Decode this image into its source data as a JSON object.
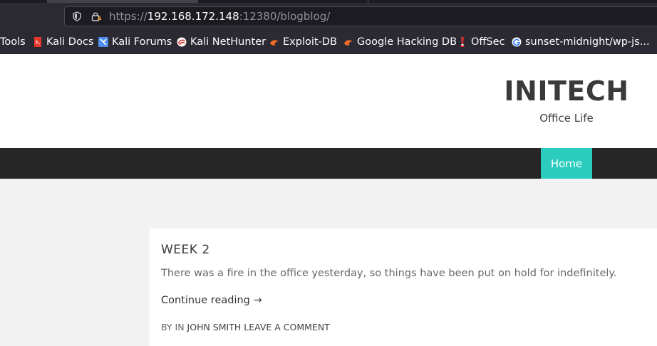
{
  "browser": {
    "url_prefix": "https://",
    "url_host": "192.168.172.148",
    "url_rest": ":12380/blogblog/",
    "bookmarks": [
      {
        "label": "Tools",
        "icon": "folder-icon"
      },
      {
        "label": "Kali Docs",
        "icon": "kali-docs-icon"
      },
      {
        "label": "Kali Forums",
        "icon": "kali-forums-icon"
      },
      {
        "label": "Kali NetHunter",
        "icon": "kali-nethunter-icon"
      },
      {
        "label": "Exploit-DB",
        "icon": "exploit-db-icon"
      },
      {
        "label": "Google Hacking DB",
        "icon": "exploit-db-icon"
      },
      {
        "label": "OffSec",
        "icon": "offsec-icon"
      },
      {
        "label": "sunset-midnight/wp-js...",
        "icon": "google-icon"
      }
    ]
  },
  "site": {
    "title": "INITECH",
    "description": "Office Life",
    "nav": {
      "home": "Home"
    },
    "accent": "#2bccbe"
  },
  "post": {
    "title": "WEEK 2",
    "excerpt": "There was a fire in the office yesterday, so things have been put on hold for indefinitely.",
    "read_more": "Continue reading →",
    "meta_by": "BY",
    "meta_in": "IN",
    "author": "JOHN SMITH",
    "comment_link": "LEAVE A COMMENT"
  }
}
